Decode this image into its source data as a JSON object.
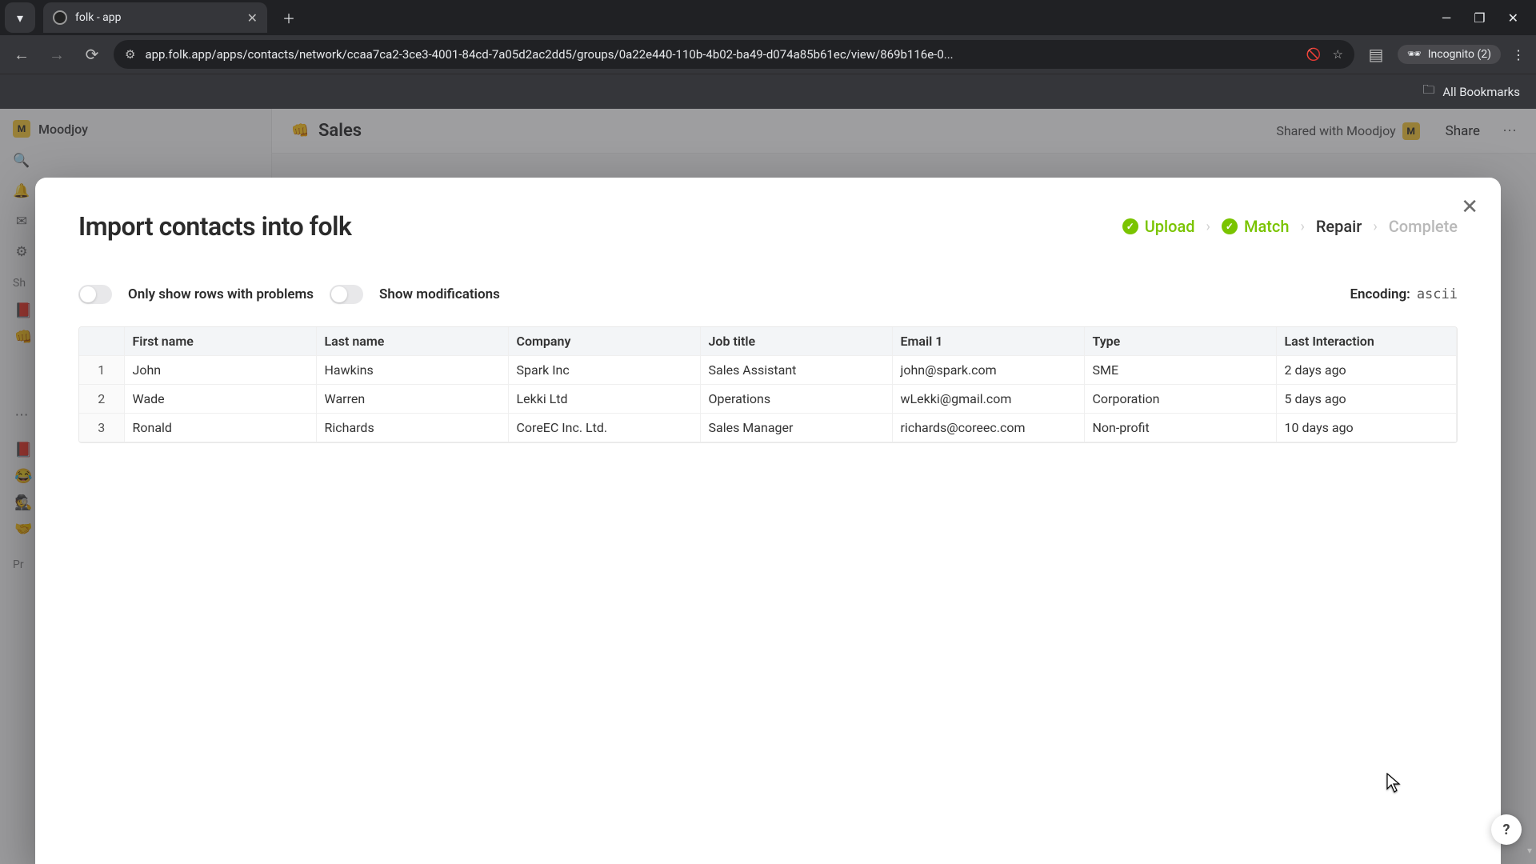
{
  "browser": {
    "tab_title": "folk - app",
    "url": "app.folk.app/apps/contacts/network/ccaa7ca2-3ce3-4001-84cd-7a05d2ac2dd5/groups/0a22e440-110b-4b02-ba49-d074a85b61ec/view/869b116e-0...",
    "incognito_label": "Incognito (2)",
    "all_bookmarks": "All Bookmarks"
  },
  "app": {
    "workspace": "Moodjoy",
    "workspace_initial": "M",
    "page_title": "Sales",
    "page_emoji": "👊",
    "shared_with_label": "Shared with Moodjoy",
    "share": "Share",
    "side_section1": "Sh",
    "side_section2": "Pr"
  },
  "modal": {
    "title": "Import contacts into folk",
    "steps": {
      "upload": "Upload",
      "match": "Match",
      "repair": "Repair",
      "complete": "Complete"
    },
    "toggle_problems": "Only show rows with problems",
    "toggle_mods": "Show modifications",
    "encoding_label": "Encoding:",
    "encoding_value": "ascii",
    "columns": [
      "First name",
      "Last name",
      "Company",
      "Job title",
      "Email 1",
      "Type",
      "Last Interaction"
    ],
    "rows": [
      {
        "n": "1",
        "first": "John",
        "last": "Hawkins",
        "company": "Spark Inc",
        "job": "Sales Assistant",
        "email": "john@spark.com",
        "type": "SME",
        "last_int": "2 days ago"
      },
      {
        "n": "2",
        "first": "Wade",
        "last": "Warren",
        "company": "Lekki Ltd",
        "job": "Operations",
        "email": "wLekki@gmail.com",
        "type": "Corporation",
        "last_int": "5 days ago"
      },
      {
        "n": "3",
        "first": "Ronald",
        "last": "Richards",
        "company": "CoreEC Inc. Ltd.",
        "job": "Sales Manager",
        "email": "richards@coreec.com",
        "type": "Non-profit",
        "last_int": "10 days ago"
      }
    ]
  },
  "help": "?"
}
